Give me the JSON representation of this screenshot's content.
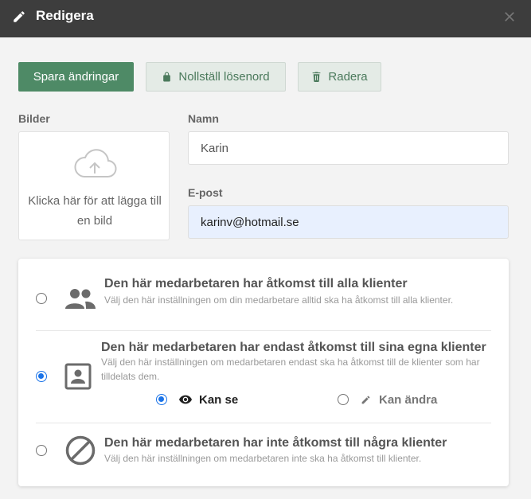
{
  "dialog": {
    "title": "Redigera",
    "close_icon": "close-icon"
  },
  "toolbar": {
    "save_label": "Spara ändringar",
    "reset_password_label": "Nollställ lösenord",
    "delete_label": "Radera"
  },
  "images": {
    "label": "Bilder",
    "hint": "Klicka här för att lägga till en bild"
  },
  "form": {
    "name_label": "Namn",
    "name_value": "Karin",
    "email_label": "E-post",
    "email_value": "karinv@hotmail.se"
  },
  "access": {
    "options": [
      {
        "title": "Den här medarbetaren har åtkomst till alla klienter",
        "description": "Välj den här inställningen om din medarbetare alltid ska ha åtkomst till alla klienter.",
        "icon": "users-icon",
        "selected": false
      },
      {
        "title": "Den här medarbetaren har endast åtkomst till sina egna klienter",
        "description": "Välj den här inställningen om medarbetaren endast ska ha åtkomst till de klienter som har tilldelats dem.",
        "icon": "contact-card-icon",
        "selected": true
      },
      {
        "title": "Den här medarbetaren har inte åtkomst till några klienter",
        "description": "Välj den här inställningen om medarbetaren inte ska ha åtkomst till klienter.",
        "icon": "block-icon",
        "selected": false
      }
    ],
    "permissions": {
      "view_label": "Kan se",
      "edit_label": "Kan ändra",
      "selected": "view"
    }
  },
  "colors": {
    "primary": "#4e8a66",
    "radio_checked": "#1a73e8",
    "titlebar": "#3d3d3d"
  }
}
